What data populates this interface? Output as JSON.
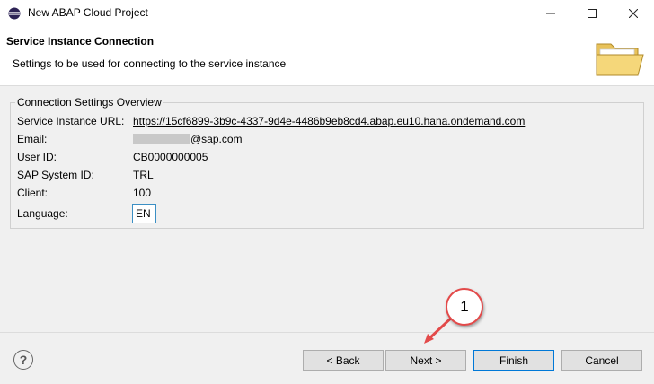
{
  "window": {
    "title": "New ABAP Cloud Project"
  },
  "header": {
    "title": "Service Instance Connection",
    "description": "Settings to be used for connecting to the service instance"
  },
  "overview": {
    "legend": "Connection Settings Overview",
    "rows": [
      {
        "label": "Service Instance URL:",
        "value": "https://15cf6899-3b9c-4337-9d4e-4486b9eb8cd4.abap.eu10.hana.ondemand.com"
      },
      {
        "label": "Email:",
        "value": "@sap.com"
      },
      {
        "label": "User ID:",
        "value": "CB0000000005"
      },
      {
        "label": "SAP System ID:",
        "value": "TRL"
      },
      {
        "label": "Client:",
        "value": "100"
      },
      {
        "label": "Language:",
        "value": "EN"
      }
    ]
  },
  "buttons": {
    "back": "< Back",
    "next": "Next >",
    "finish": "Finish",
    "cancel": "Cancel",
    "help": "?"
  },
  "callout": {
    "number": "1",
    "color": "#e34a4a"
  },
  "icons": {
    "app": "eclipse-icon",
    "header": "folder-icon",
    "help": "help-icon"
  }
}
